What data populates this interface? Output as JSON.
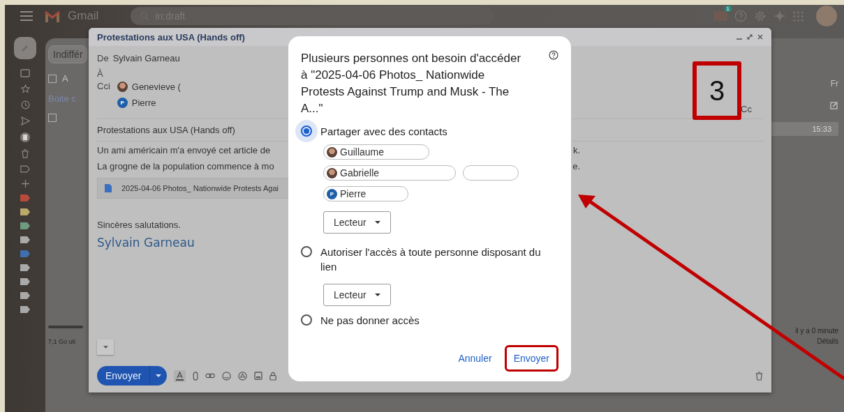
{
  "topbar": {
    "app_name": "Gmail",
    "search": {
      "value": "in:draft"
    },
    "notification_badge": "1"
  },
  "rail": {
    "labels": [
      {
        "color": "#b84a3c"
      },
      {
        "color": "#b9aa6a"
      },
      {
        "color": "#6f9a80"
      },
      {
        "color": "#a9a9a9"
      },
      {
        "color": "#3f6fb0"
      },
      {
        "color": "#a9a9a9"
      },
      {
        "color": "#a9a9a9"
      },
      {
        "color": "#a9a9a9"
      },
      {
        "color": "#a9a9a9"
      }
    ]
  },
  "mail_list": {
    "select_all_checked": false,
    "row_checked": false,
    "filter": "Indiffér",
    "select_label": "A",
    "tab": "Boite c",
    "language": "Fr",
    "time": "15:33",
    "storage": "7,1 Go uti",
    "activity": "il y a 0 minute",
    "details_link": "Détails"
  },
  "compose": {
    "title": "Protestations aux USA (Hands off)",
    "from_label": "De",
    "from": "Sylvain Garneau",
    "to_label": "À",
    "bcc_label": "Cci",
    "cc_label": "Cc",
    "bcc_chips": [
      {
        "name": "Genevieve (",
        "kind": "photo"
      },
      {
        "name": "Pierre",
        "kind": "letter",
        "letter": "P"
      }
    ],
    "subject": "Protestations aux USA (Hands off)",
    "body_lines": [
      {
        "start": "Un ami américain m'a envoyé cet article de",
        "end": "k."
      },
      {
        "start": "La grogne de la population commence à mo",
        "end": "e."
      }
    ],
    "attachment": "2025-04-06 Photos_ Nationwide Protests Agai",
    "closing": "Sincères salutations.",
    "signature": "Sylvain Garneau",
    "send_button": "Envoyer"
  },
  "dialog": {
    "title": "Plusieurs personnes ont besoin d'accéder à \"2025-04-06 Photos_ Nationwide Protests Against Trump and Musk - The A...\"",
    "options": [
      {
        "label": "Partager avec des contacts",
        "selected": true,
        "chips": [
          {
            "name": "Guillaume",
            "kind": "photo"
          },
          {
            "name": "Gabrielle",
            "kind": "photo"
          },
          {
            "name": "Pierre",
            "kind": "letter",
            "letter": "P"
          }
        ],
        "role": "Lecteur"
      },
      {
        "label": "Autoriser l'accès à toute personne disposant du lien",
        "selected": false,
        "role": "Lecteur"
      },
      {
        "label": "Ne pas donner accès",
        "selected": false
      }
    ],
    "buttons": [
      {
        "label": "Annuler",
        "highlighted": false
      },
      {
        "label": "Envoyer",
        "highlighted": true
      }
    ]
  },
  "annotation": {
    "step_number": "3"
  }
}
